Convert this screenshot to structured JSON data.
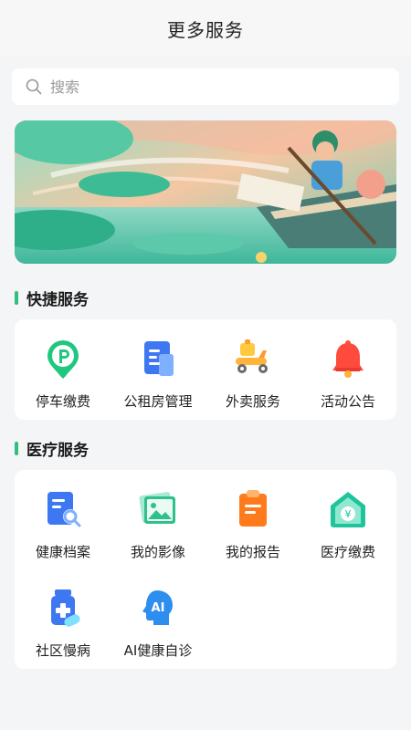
{
  "header": {
    "title": "更多服务"
  },
  "search": {
    "placeholder": "搜索"
  },
  "quick_services": {
    "title": "快捷服务",
    "items": [
      {
        "label": "停车缴费",
        "icon": "parking-icon"
      },
      {
        "label": "公租房管理",
        "icon": "document-icon"
      },
      {
        "label": "外卖服务",
        "icon": "delivery-scooter-icon"
      },
      {
        "label": "活动公告",
        "icon": "bell-icon"
      }
    ]
  },
  "medical_services": {
    "title": "医疗服务",
    "items": [
      {
        "label": "健康档案",
        "icon": "health-record-icon"
      },
      {
        "label": "我的影像",
        "icon": "image-icon"
      },
      {
        "label": "我的报告",
        "icon": "report-clipboard-icon"
      },
      {
        "label": "医疗缴费",
        "icon": "payment-house-icon"
      },
      {
        "label": "社区慢病",
        "icon": "medicine-bottle-icon"
      },
      {
        "label": "AI健康自诊",
        "icon": "ai-head-icon"
      }
    ]
  },
  "colors": {
    "accent": "#2fbf7f",
    "background": "#f4f5f7"
  }
}
